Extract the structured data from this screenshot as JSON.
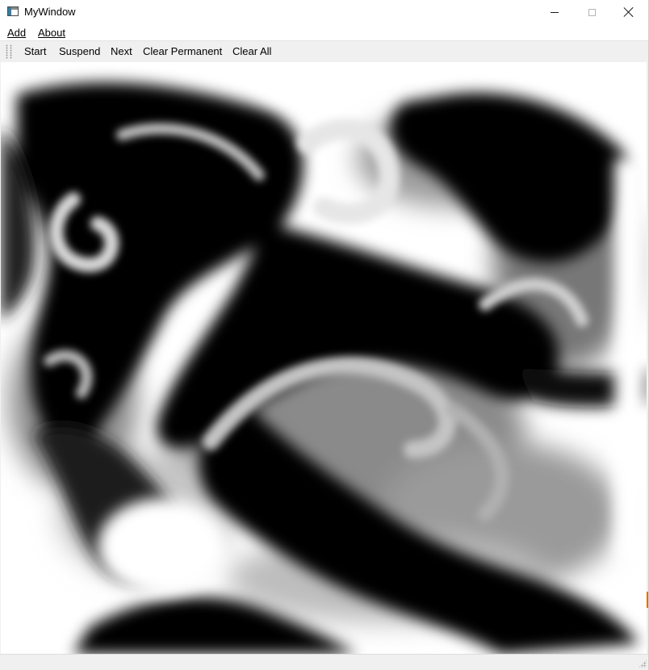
{
  "window": {
    "title": "MyWindow"
  },
  "menu": {
    "add_label": "Add",
    "about_label": "About"
  },
  "toolbar": {
    "start_label": "Start",
    "suspend_label": "Suspend",
    "next_label": "Next",
    "clear_permanent_label": "Clear Permanent",
    "clear_all_label": "Clear All"
  },
  "icons": {
    "app": "app-window-icon",
    "minimize": "minimize-icon",
    "maximize": "maximize-icon",
    "close": "close-icon"
  },
  "canvas": {
    "content": "grayscale-fluid-simulation",
    "colors": {
      "dye": "#000000",
      "background": "#ffffff"
    }
  }
}
